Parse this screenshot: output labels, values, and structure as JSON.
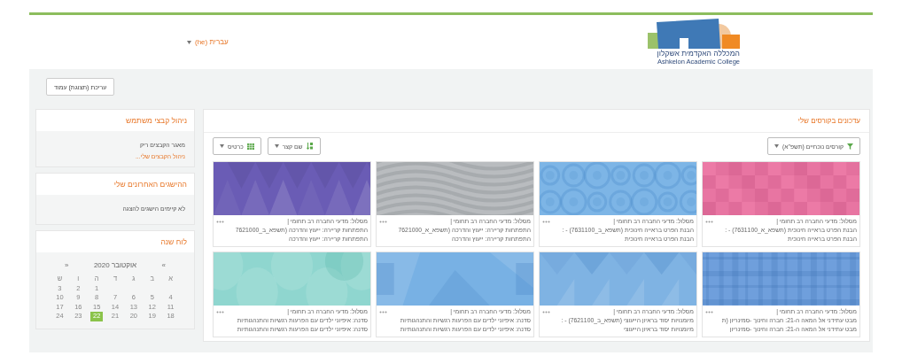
{
  "header": {
    "language": "עברית (he)",
    "logo": {
      "name_he": "המכללה האקדמית אשקלון",
      "name_en": "Ashkelon Academic College"
    }
  },
  "edit_button": "עריכת (תצוגת) עמוד",
  "main": {
    "title": "עדכונים בקורסים שלי",
    "filter": "קורסים נוכחיים (תשפ\"א)",
    "sort": "שם קצר",
    "view": "כרטיס",
    "courses": [
      {
        "kind": "squares",
        "color": "#ec7aa6",
        "category": "מסלול: מדעי החברה רב תחומי |",
        "title": "הבנת הפרט בראייה חינוכית (תשפא_א_7631100) - :",
        "subtitle": "הבנת הפרט בראייה חינוכית"
      },
      {
        "kind": "circles",
        "color": "#7db5e6",
        "category": "מסלול: מדעי החברה רב תחומי |",
        "title": "הבנת הפרט בראייה חינוכית (תשפא_ב_7631100) - :",
        "subtitle": "הבנת הפרט בראייה חינוכית"
      },
      {
        "kind": "waves",
        "color": "#b9bcbf",
        "category": "מסלול: מדעי החברה רב תחומי |",
        "title": "התפתחות קריירה: ייעוץ והדרכה (תשפא_א_7621000",
        "subtitle": "התפתחות קריירה: ייעוץ והדרכה"
      },
      {
        "kind": "triangles",
        "color": "#6a5cb5",
        "category": "מסלול: מדעי החברה רב תחומי |",
        "title": "התפתחות קריירה: ייעוץ והדרכה (תשפא_ב_7621000",
        "subtitle": "התפתחות קריירה: ייעוץ והדרכה"
      },
      {
        "kind": "plaid",
        "color": "#6f9fdc",
        "category": "מסלול: מדעי החברה רב תחומי |",
        "title": "מבט עתידני אל המאה ה-21: חברה וחינוך -סמינריון (ת",
        "subtitle": "מבט עתידני אל המאה ה-21: חברה וחינוך -סמינריון"
      },
      {
        "kind": "diamonds",
        "color": "#7fb3e3",
        "category": "מסלול: מדעי החברה רב תחומי |",
        "title": "מיומנויות יסוד בראיון הייעוצי (תשפא_ב_7621100) - :",
        "subtitle": "מיומנויות יסוד בראיון הייעוצי"
      },
      {
        "kind": "polygons",
        "color": "#78b1e4",
        "category": "מסלול: מדעי החברה רב תחומי |",
        "title": "סדנה: איפיוני ילדים עם הפרעות רגשיות והתנהגותיות",
        "subtitle": "סדנה: איפיוני ילדים עם הפרעות רגשיות והתנהגותיות"
      },
      {
        "kind": "bubbles",
        "color": "#8fd6cf",
        "category": "מסלול: מדעי החברה רב תחומי |",
        "title": "סדנה: איפיוני ילדים עם הפרעות רגשיות והתנהגותיות",
        "subtitle": "סדנה: איפיוני ילדים עם הפרעות רגשיות והתנהגותיות"
      }
    ]
  },
  "sidebar": {
    "blocks": [
      {
        "kind": "files",
        "title": "ניהול קבצי משתמש",
        "text": "מאגר הקבצים ריק",
        "link": "ניהול הקבצים שלי..."
      },
      {
        "kind": "badges",
        "title": "ההישגים האחרונים שלי",
        "text": "לא קיימים הישגים להצגה"
      },
      {
        "kind": "calendar",
        "title": "לוח שנה",
        "prev": "»",
        "month": "אוקטובר 2020",
        "next": "«",
        "weekdays": [
          "א",
          "ב",
          "ג",
          "ד",
          "ה",
          "ו",
          "ש"
        ],
        "days": [
          {
            "kind": "blank"
          },
          {
            "kind": "blank"
          },
          {
            "kind": "blank"
          },
          {
            "kind": "blank"
          },
          {
            "kind": "day",
            "day": "1",
            "today": false
          },
          {
            "kind": "day",
            "day": "2",
            "today": false
          },
          {
            "kind": "day",
            "day": "3",
            "today": false
          },
          {
            "kind": "day",
            "day": "4",
            "today": false
          },
          {
            "kind": "day",
            "day": "5",
            "today": false
          },
          {
            "kind": "day",
            "day": "6",
            "today": false
          },
          {
            "kind": "day",
            "day": "7",
            "today": false
          },
          {
            "kind": "day",
            "day": "8",
            "today": false
          },
          {
            "kind": "day",
            "day": "9",
            "today": false
          },
          {
            "kind": "day",
            "day": "10",
            "today": false
          },
          {
            "kind": "day",
            "day": "11",
            "today": false
          },
          {
            "kind": "day",
            "day": "12",
            "today": false
          },
          {
            "kind": "day",
            "day": "13",
            "today": false
          },
          {
            "kind": "day",
            "day": "14",
            "today": false
          },
          {
            "kind": "day",
            "day": "15",
            "today": false
          },
          {
            "kind": "day",
            "day": "16",
            "today": false
          },
          {
            "kind": "day",
            "day": "17",
            "today": false
          },
          {
            "kind": "day",
            "day": "18",
            "today": false
          },
          {
            "kind": "day",
            "day": "19",
            "today": false
          },
          {
            "kind": "day",
            "day": "20",
            "today": false
          },
          {
            "kind": "day",
            "day": "21",
            "today": false
          },
          {
            "kind": "day",
            "day": "22",
            "today": true
          },
          {
            "kind": "day",
            "day": "23",
            "today": false
          },
          {
            "kind": "day",
            "day": "24",
            "today": false
          }
        ]
      }
    ]
  }
}
